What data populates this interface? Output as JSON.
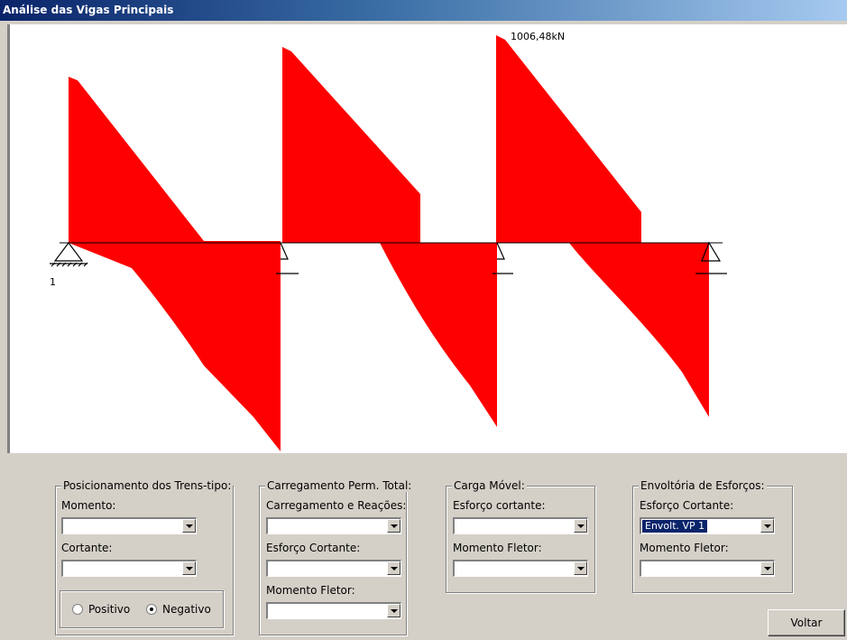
{
  "window": {
    "title": "Análise das Vigas Principais"
  },
  "diagram": {
    "peak_label": "1006,48kN",
    "support_number": "1",
    "fill_color": "#ff0000"
  },
  "groups": {
    "trens_tipo": {
      "title": "Posicionamento dos Trens-tipo:",
      "momento_label": "Momento:",
      "momento_value": "",
      "cortante_label": "Cortante:",
      "cortante_value": "",
      "positivo_label": "Positivo",
      "negativo_label": "Negativo",
      "selected": "Negativo"
    },
    "perm": {
      "title": "Carregamento Perm. Total:",
      "reacoes_label": "Carregamento e Reações:",
      "reacoes_value": "",
      "cortante_label": "Esforço Cortante:",
      "cortante_value": "",
      "momento_label": "Momento Fletor:",
      "momento_value": ""
    },
    "movel": {
      "title": "Carga Móvel:",
      "cortante_label": "Esforço cortante:",
      "cortante_value": "",
      "momento_label": "Momento Fletor:",
      "momento_value": ""
    },
    "envoltoria": {
      "title": "Envoltória de Esforços:",
      "cortante_label": "Esforço Cortante:",
      "cortante_value": "Envolt. VP 1",
      "momento_label": "Momento Fletor:",
      "momento_value": ""
    }
  },
  "buttons": {
    "voltar": "Voltar"
  }
}
